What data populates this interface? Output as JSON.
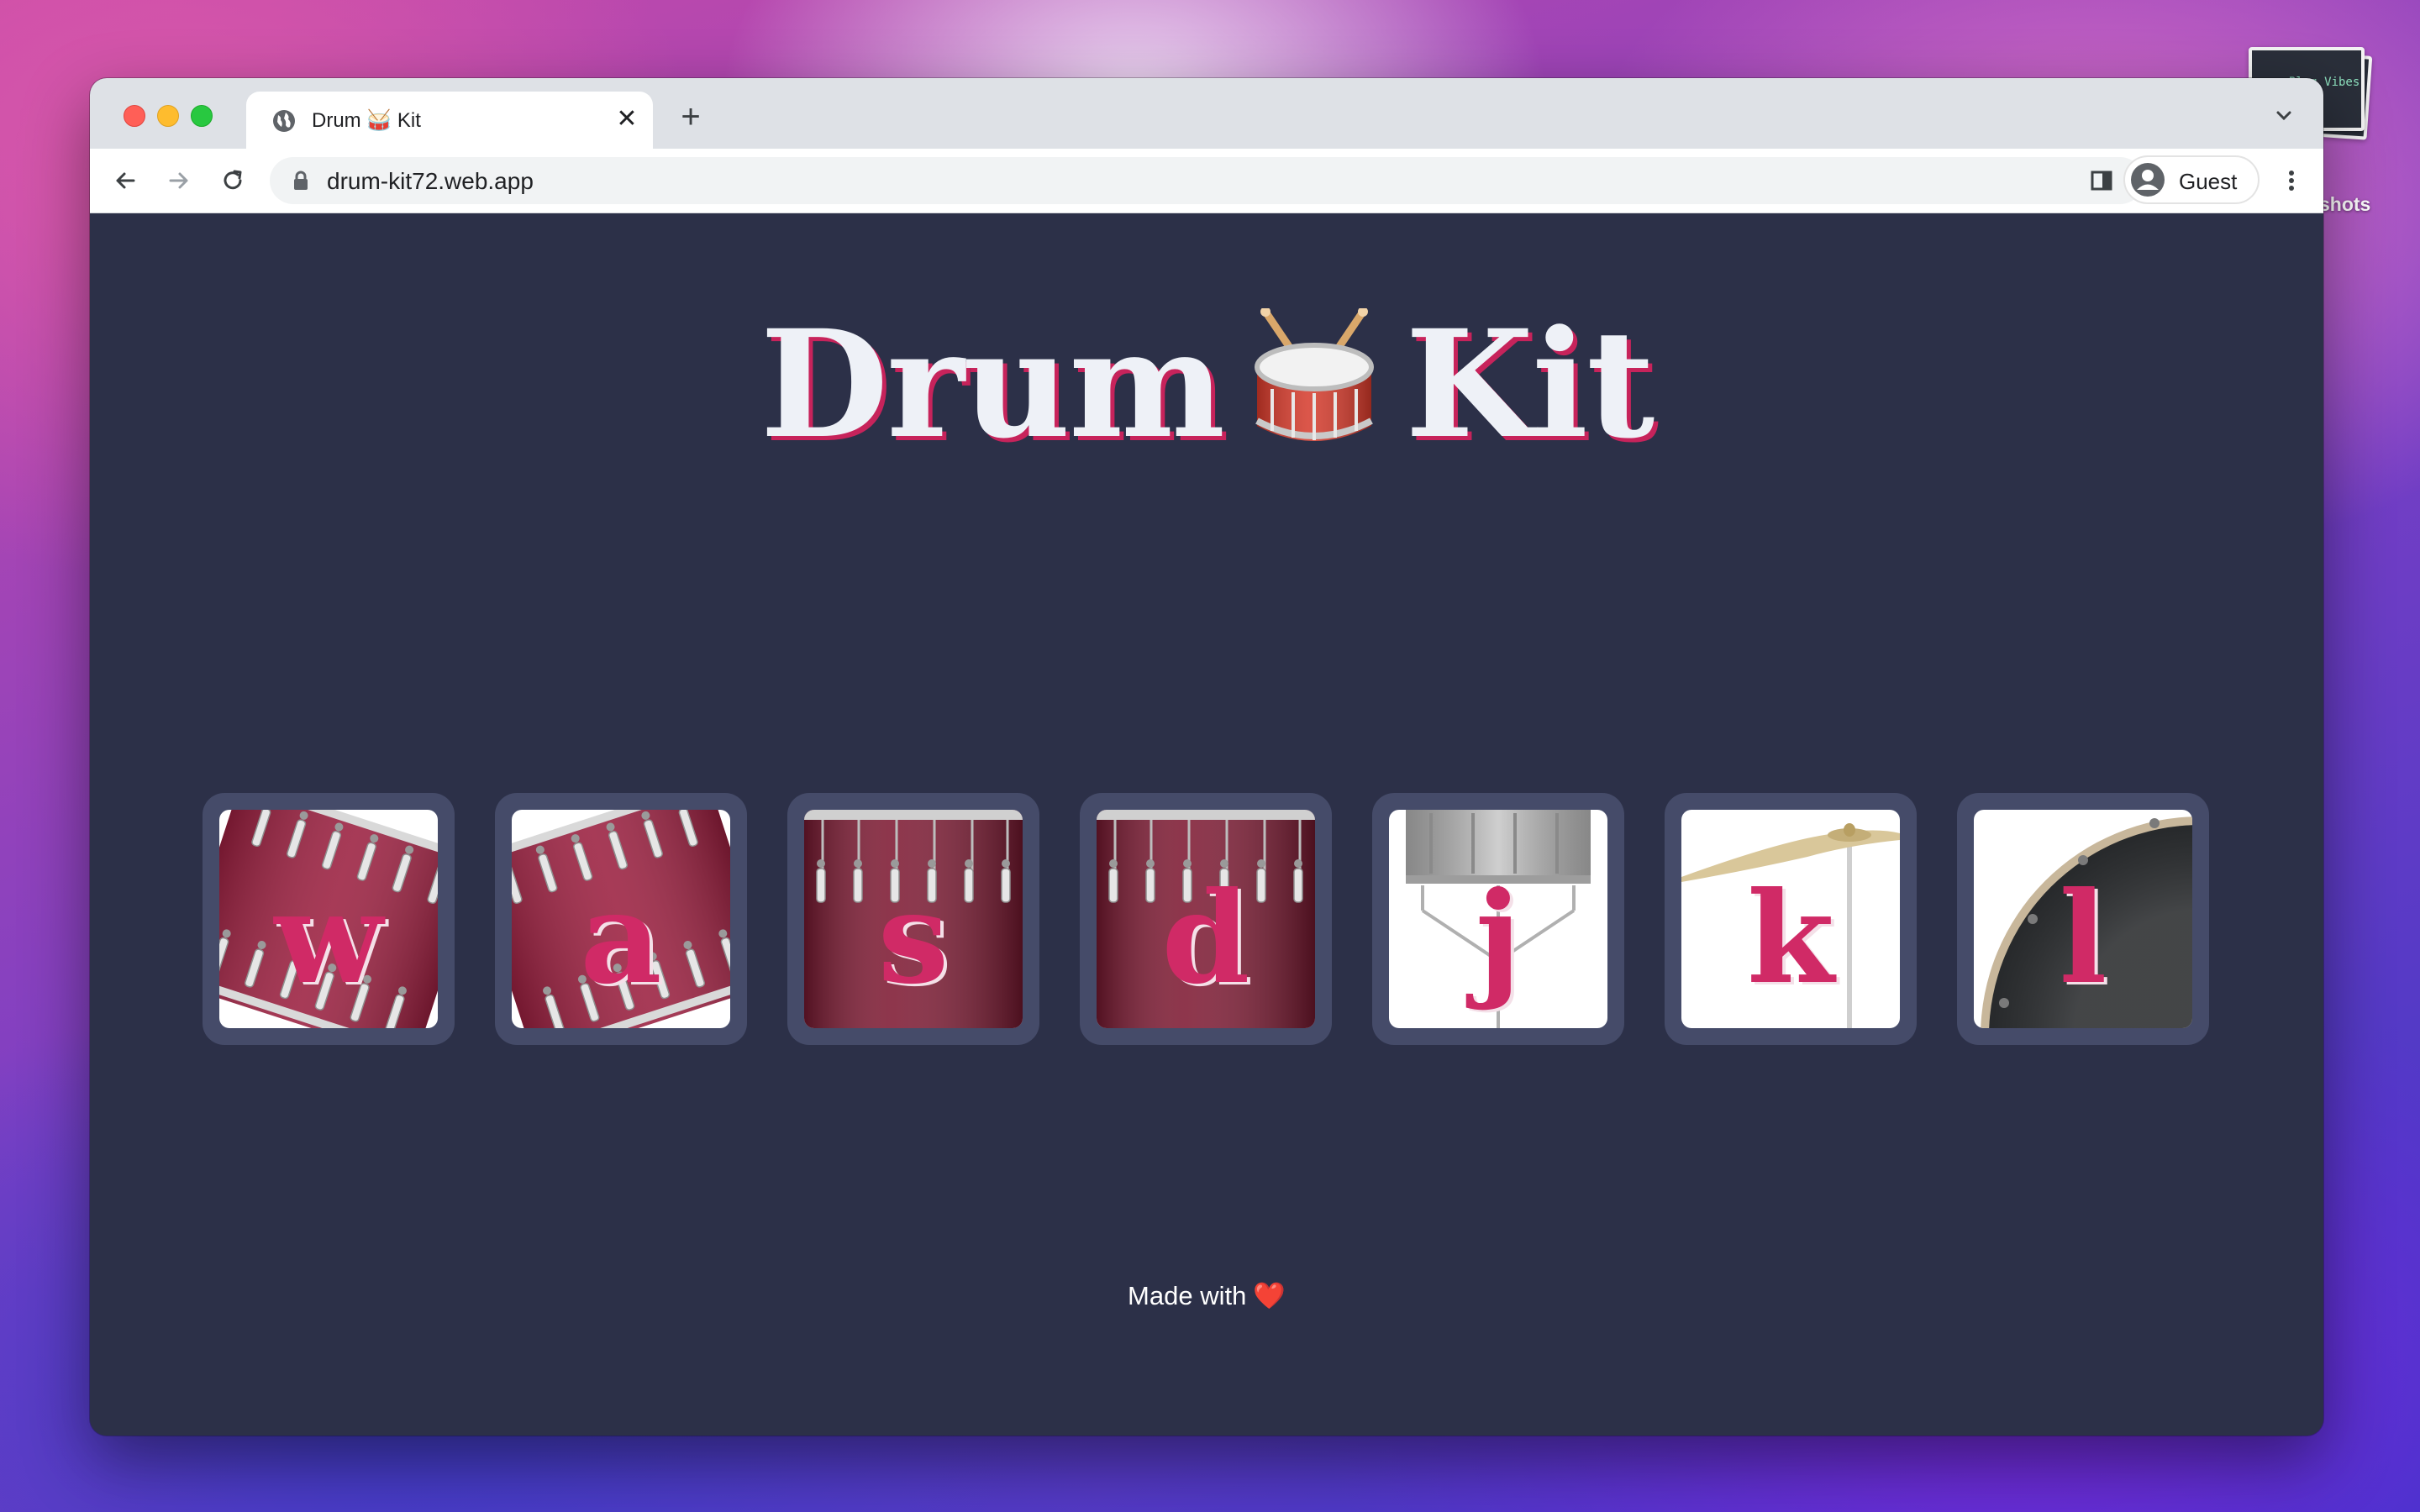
{
  "browser": {
    "tab_title": "Drum 🥁 Kit",
    "url": "drum-kit72.web.app",
    "profile_label": "Guest",
    "new_tab_symbol": "+",
    "close_symbol": "✕"
  },
  "desktop": {
    "folder_label": "shots",
    "thumbnail_text": "Blog Vibes"
  },
  "page": {
    "title_left": "Drum",
    "title_right": "Kit",
    "title_emoji": "drum-with-drumsticks",
    "footer_text": "Made with",
    "footer_heart": "❤️"
  },
  "pads": [
    {
      "key": "w",
      "drum": "tom-tilted-left"
    },
    {
      "key": "a",
      "drum": "tom-tilted-right"
    },
    {
      "key": "s",
      "drum": "floor-tom"
    },
    {
      "key": "d",
      "drum": "floor-tom"
    },
    {
      "key": "j",
      "drum": "snare"
    },
    {
      "key": "k",
      "drum": "crash-cymbal"
    },
    {
      "key": "l",
      "drum": "bass-drum"
    }
  ],
  "colors": {
    "page_background": "#2c3048",
    "pad_frame": "#454b69",
    "key_letter": "#d02a66",
    "title_shadow": "#c7235b"
  }
}
